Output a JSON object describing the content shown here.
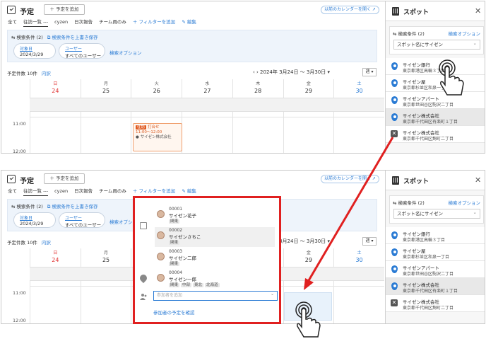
{
  "header": {
    "title": "予定",
    "add_label": "＋ 予定を追加",
    "prev_calendar": "以前のカレンダーを開く ↗"
  },
  "tabs": {
    "all": "全て",
    "sales": "往訪一覧 ---",
    "cyzen": "cyzen",
    "daily": "日次報告",
    "team": "チーム員のみ",
    "add_filter": "＋ フィルターを追加",
    "edit": "✎ 編集"
  },
  "filter": {
    "condition": "⇆ 検索条件 (2)",
    "overwrite": "⧉ 検索条件を上書き保存",
    "date_label": "対象日",
    "date_value": "2024/3/29",
    "user_label": "ユーザー",
    "user_value": "すべてのユーザー",
    "search_option": "検索オプション"
  },
  "subbar": {
    "count": "予定件数 10件",
    "breakdown": "内訳"
  },
  "range": {
    "text": "‹  ›  2024年 3月24日 〜 3月30日  ▾",
    "week": "週 ▾"
  },
  "days": [
    {
      "dn": "日",
      "dd": "24"
    },
    {
      "dn": "月",
      "dd": "25"
    },
    {
      "dn": "火",
      "dd": "26"
    },
    {
      "dn": "水",
      "dd": "27"
    },
    {
      "dn": "木",
      "dd": "28"
    },
    {
      "dn": "金",
      "dd": "29"
    },
    {
      "dn": "土",
      "dd": "30"
    }
  ],
  "times": {
    "t1": "11:00",
    "t2": "12:00"
  },
  "event": {
    "tag": "往訪",
    "title": "打合せ",
    "time": "11:00〜12:00",
    "place": "サイゼン株式会社"
  },
  "side": {
    "title": "スポット",
    "close": "✕",
    "condition": "⇆ 検索条件 (2)",
    "search_option": "検索オプション",
    "select": "スポット名にサイゼン",
    "spots": [
      {
        "name": "サイゼン銀行",
        "address": "東京都港区高輪３丁目"
      },
      {
        "name": "サイゼン屋",
        "address": "東京都杉並区和泉一丁目"
      },
      {
        "name": "サイゼンアパート",
        "address": "東京都世田谷区駒沢二丁目"
      },
      {
        "name": "サイゼン株式会社",
        "address": "東京都千代田区有楽町１丁目"
      },
      {
        "name": "サイゼン株式会社",
        "address": "東京都千代田区麹町二丁目"
      }
    ]
  },
  "popup": {
    "members": [
      {
        "id": "00001",
        "name": "サイゼン花子",
        "tags": [
          "関東"
        ]
      },
      {
        "id": "00002",
        "name": "サイゼンさちこ",
        "tags": [
          "関東"
        ]
      },
      {
        "id": "00003",
        "name": "サイゼン二郎",
        "tags": [
          "関東"
        ]
      },
      {
        "id": "00004",
        "name": "サイゼン一郎",
        "tags": [
          "関東",
          "中部",
          "東北",
          "北海道"
        ]
      }
    ],
    "placeholder": "参加者を追加",
    "confirm": "参加者の予定を確認"
  },
  "colors": {
    "accent": "#2a7bd4",
    "highlight_border": "#e02020",
    "arrow": "#e02020"
  }
}
